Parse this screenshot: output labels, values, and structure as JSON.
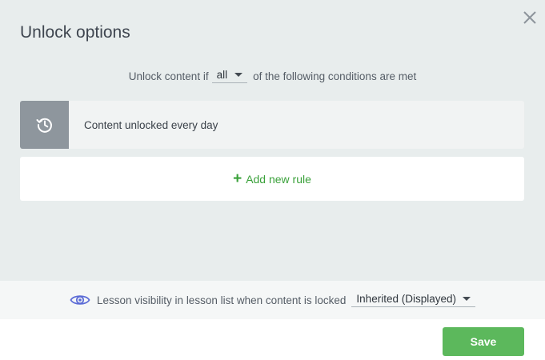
{
  "dialog": {
    "title": "Unlock options"
  },
  "condition": {
    "prefix": "Unlock content if",
    "selected": "all",
    "suffix": "of the following conditions are met"
  },
  "rules": [
    {
      "label": "Content unlocked every day",
      "icon": "history-icon"
    }
  ],
  "add_rule": {
    "plus": "+",
    "label": "Add new rule"
  },
  "visibility": {
    "label": "Lesson visibility in lesson list when content is locked",
    "selected": "Inherited (Displayed)",
    "icon": "eye-icon"
  },
  "footer": {
    "save_label": "Save"
  },
  "colors": {
    "background": "#e8eded",
    "accent_green": "#5cb85c",
    "link_green": "#3aa13a",
    "rule_icon_bg": "#8e969d",
    "eye_icon": "#5b6bd6"
  }
}
